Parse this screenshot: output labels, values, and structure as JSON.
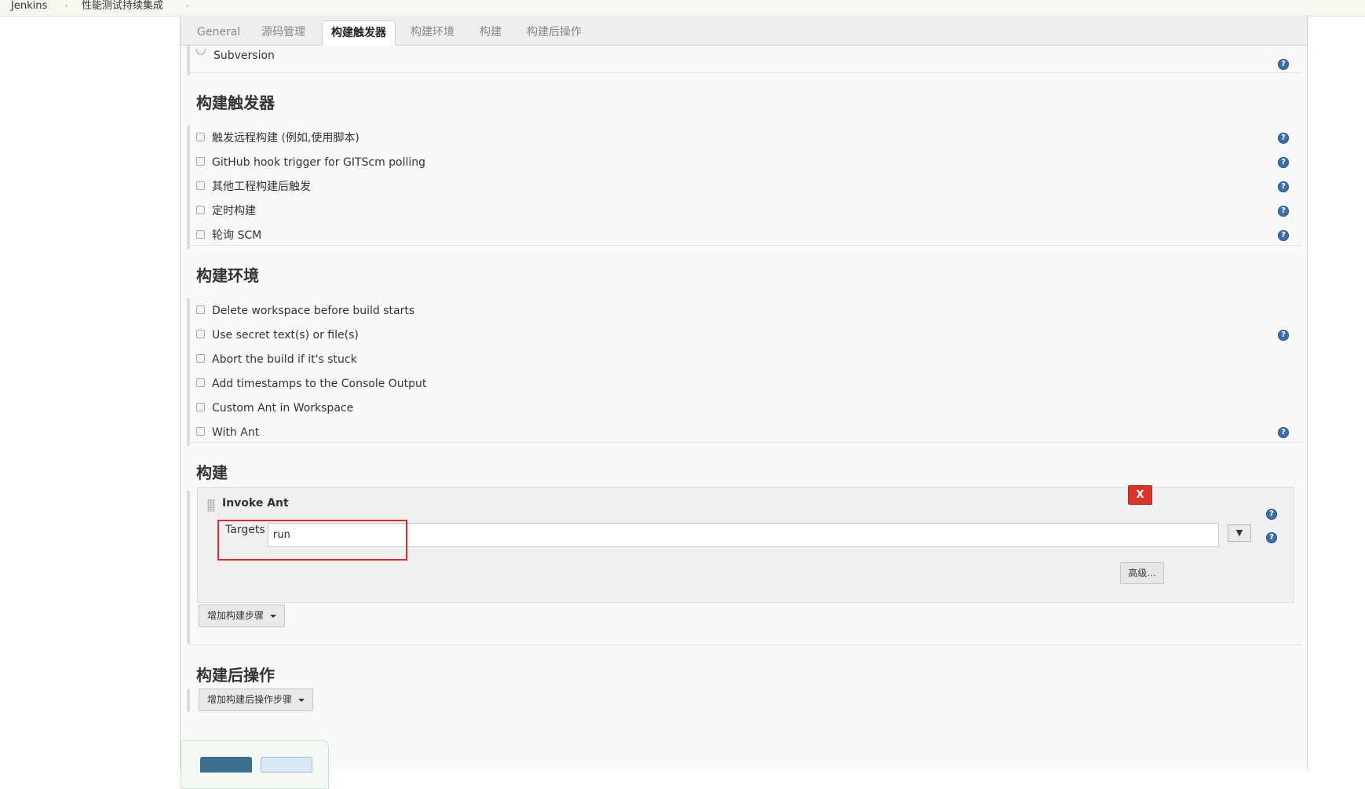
{
  "breadcrumb": {
    "items": [
      "Jenkins",
      "性能测试持续集成"
    ],
    "separator": "›"
  },
  "tabs": [
    {
      "label": "General"
    },
    {
      "label": "源码管理"
    },
    {
      "label": "构建触发器",
      "active": true
    },
    {
      "label": "构建环境"
    },
    {
      "label": "构建"
    },
    {
      "label": "构建后操作"
    }
  ],
  "scm": {
    "partial_option": "Subversion"
  },
  "triggers": {
    "title": "构建触发器",
    "options": [
      {
        "label": "触发远程构建 (例如,使用脚本)",
        "checked": false
      },
      {
        "label": "GitHub hook trigger for GITScm polling",
        "checked": false
      },
      {
        "label": "其他工程构建后触发",
        "checked": false
      },
      {
        "label": "定时构建",
        "checked": false
      },
      {
        "label": "轮询 SCM",
        "checked": false
      }
    ]
  },
  "environment": {
    "title": "构建环境",
    "options": [
      {
        "label": "Delete workspace before build starts",
        "checked": false
      },
      {
        "label": "Use secret text(s) or file(s)",
        "checked": false
      },
      {
        "label": "Abort the build if it's stuck",
        "checked": false
      },
      {
        "label": "Add timestamps to the Console Output",
        "checked": false
      },
      {
        "label": "Custom Ant in Workspace",
        "checked": false
      },
      {
        "label": "With Ant",
        "checked": false
      }
    ]
  },
  "build": {
    "title": "构建",
    "step": {
      "title": "Invoke Ant",
      "delete_label": "X",
      "targets_label": "Targets",
      "targets_value": "run",
      "expand_symbol": "▼",
      "advanced_label": "高级..."
    },
    "add_step_label": "增加构建步骤"
  },
  "post_build": {
    "title": "构建后操作",
    "add_step_label": "增加构建后操作步骤"
  },
  "help_symbol": "?",
  "colors": {
    "delete": "#d9362b",
    "highlight": "#e0292f",
    "help": "#3d6fa8",
    "save": "#3c6f8f"
  }
}
